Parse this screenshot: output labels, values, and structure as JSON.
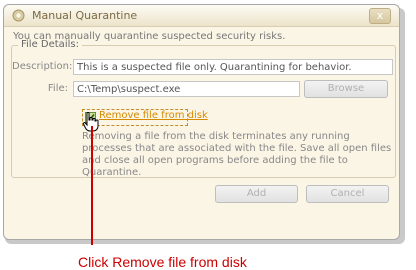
{
  "window": {
    "title": "Manual Quarantine",
    "close_symbol": "x",
    "description": "You can manually quarantine suspected security risks."
  },
  "file_details": {
    "legend": "File Details:",
    "description_label": "Description:",
    "description_value": "This is a suspected file only. Quarantining for behavior.",
    "file_label": "File:",
    "file_value": "C:\\Temp\\suspect.exe",
    "browse_label": "Browse",
    "checkbox_label": "Remove file from disk",
    "checkbox_checked": true,
    "info_text": "Removing a file from the disk terminates any running processes that are associated with the file. Save all open files and close all open programs before adding the file to Quarantine."
  },
  "footer": {
    "add_label": "Add",
    "cancel_label": "Cancel"
  },
  "callout": {
    "text": "Click Remove file from disk",
    "color": "#cc0000"
  }
}
